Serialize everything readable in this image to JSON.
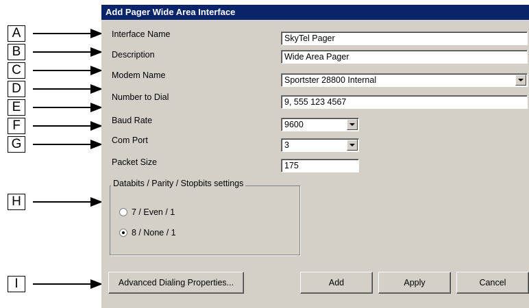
{
  "callouts": [
    "A",
    "B",
    "C",
    "D",
    "E",
    "F",
    "G",
    "H",
    "I"
  ],
  "dialog": {
    "title": "Add Pager Wide Area Interface",
    "fields": {
      "interface_name": {
        "label": "Interface Name",
        "value": "SkyTel Pager"
      },
      "description": {
        "label": "Description",
        "value": "Wide Area Pager"
      },
      "modem_name": {
        "label": "Modem Name",
        "value": "Sportster 28800 Internal"
      },
      "number_to_dial": {
        "label": "Number to Dial",
        "value": "9, 555 123 4567"
      },
      "baud_rate": {
        "label": "Baud Rate",
        "value": "9600"
      },
      "com_port": {
        "label": "Com Port",
        "value": "3"
      },
      "packet_size": {
        "label": "Packet Size",
        "value": "175"
      }
    },
    "group": {
      "title": "Databits / Parity / Stopbits settings",
      "options": [
        "7 / Even / 1",
        "8 / None / 1"
      ],
      "selected": "8 / None / 1"
    },
    "buttons": {
      "advanced": "Advanced Dialing Properties...",
      "add": "Add",
      "apply": "Apply",
      "cancel": "Cancel"
    }
  },
  "colors": {
    "titlebar": "#0a246a",
    "dialog_bg": "#d4d0c8"
  },
  "icons": {
    "arrow": "right-arrow-icon",
    "dropdown": "chevron-down-icon"
  }
}
